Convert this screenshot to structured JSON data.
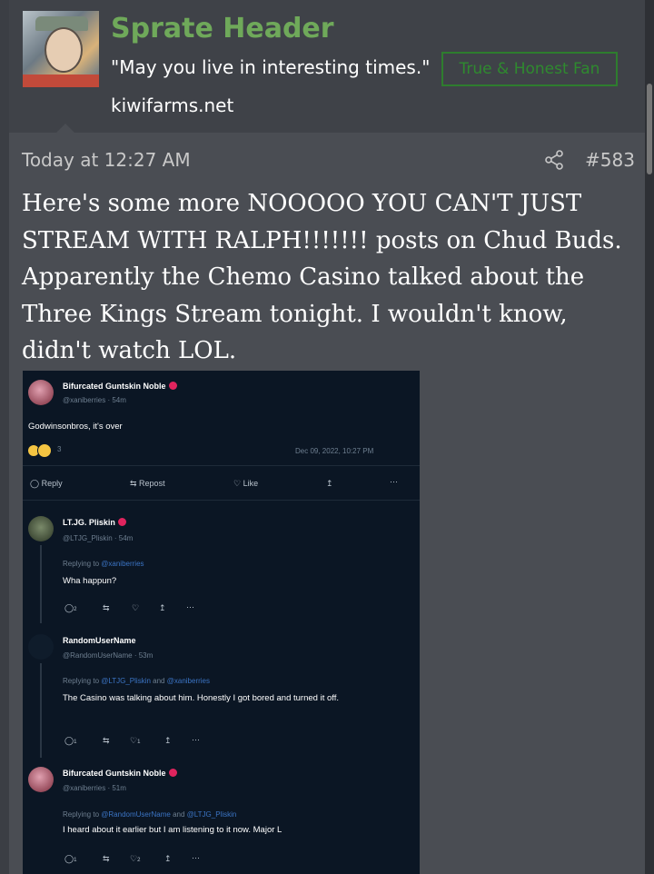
{
  "user": {
    "name": "Sprate Header",
    "title": "\"May you live in interesting times.\"",
    "banner": "True & Honest Fan",
    "website": "kiwifarms.net"
  },
  "post": {
    "time": "Today at 12:27 AM",
    "number": "#583",
    "body": "Here's some more NOOOOO YOU CAN'T JUST STREAM WITH RALPH!!!!!!! posts on Chud Buds. Apparently the Chemo Casino talked about the Three Kings Stream tonight. I wouldn't know, didn't watch LOL."
  },
  "screenshot": {
    "main": {
      "name": "Bifurcated Guntskin Noble",
      "handle": "@xaniberries",
      "age": "54m",
      "text": "Godwinsonbros, it's over",
      "reactions": "3",
      "date": "Dec 09, 2022, 10:27 PM",
      "actions": {
        "reply": "Reply",
        "repost": "Repost",
        "like": "Like"
      }
    },
    "replies": [
      {
        "name": "LT.JG. Pliskin",
        "handle": "@LTJG_Pliskin",
        "age": "54m",
        "replying_prefix": "Replying to",
        "replying_to": "@xaniberries",
        "text": "Wha happun?",
        "reply_count": "2",
        "like_count": ""
      },
      {
        "name": "RandomUserName",
        "handle": "@RandomUserName",
        "age": "53m",
        "replying_prefix": "Replying to",
        "replying_to": "@LTJG_Pliskin",
        "replying_and": "and",
        "replying_to2": "@xaniberries",
        "text": "The Casino was talking about him. Honestly I got bored and turned it off.",
        "reply_count": "1",
        "like_count": "1"
      },
      {
        "name": "Bifurcated Guntskin Noble",
        "handle": "@xaniberries",
        "age": "51m",
        "replying_prefix": "Replying to",
        "replying_to": "@RandomUserName",
        "replying_and": "and",
        "replying_to2": "@LTJG_Pliskin",
        "text": "I heard about it earlier but I am listening to it now. Major L",
        "reply_count": "1",
        "like_count": "2"
      }
    ]
  },
  "colors": {
    "accent_green": "#6fa95a",
    "banner_green": "#2f8a2f",
    "tweet_bg": "#0b1624",
    "link_blue": "#3b74c4"
  }
}
